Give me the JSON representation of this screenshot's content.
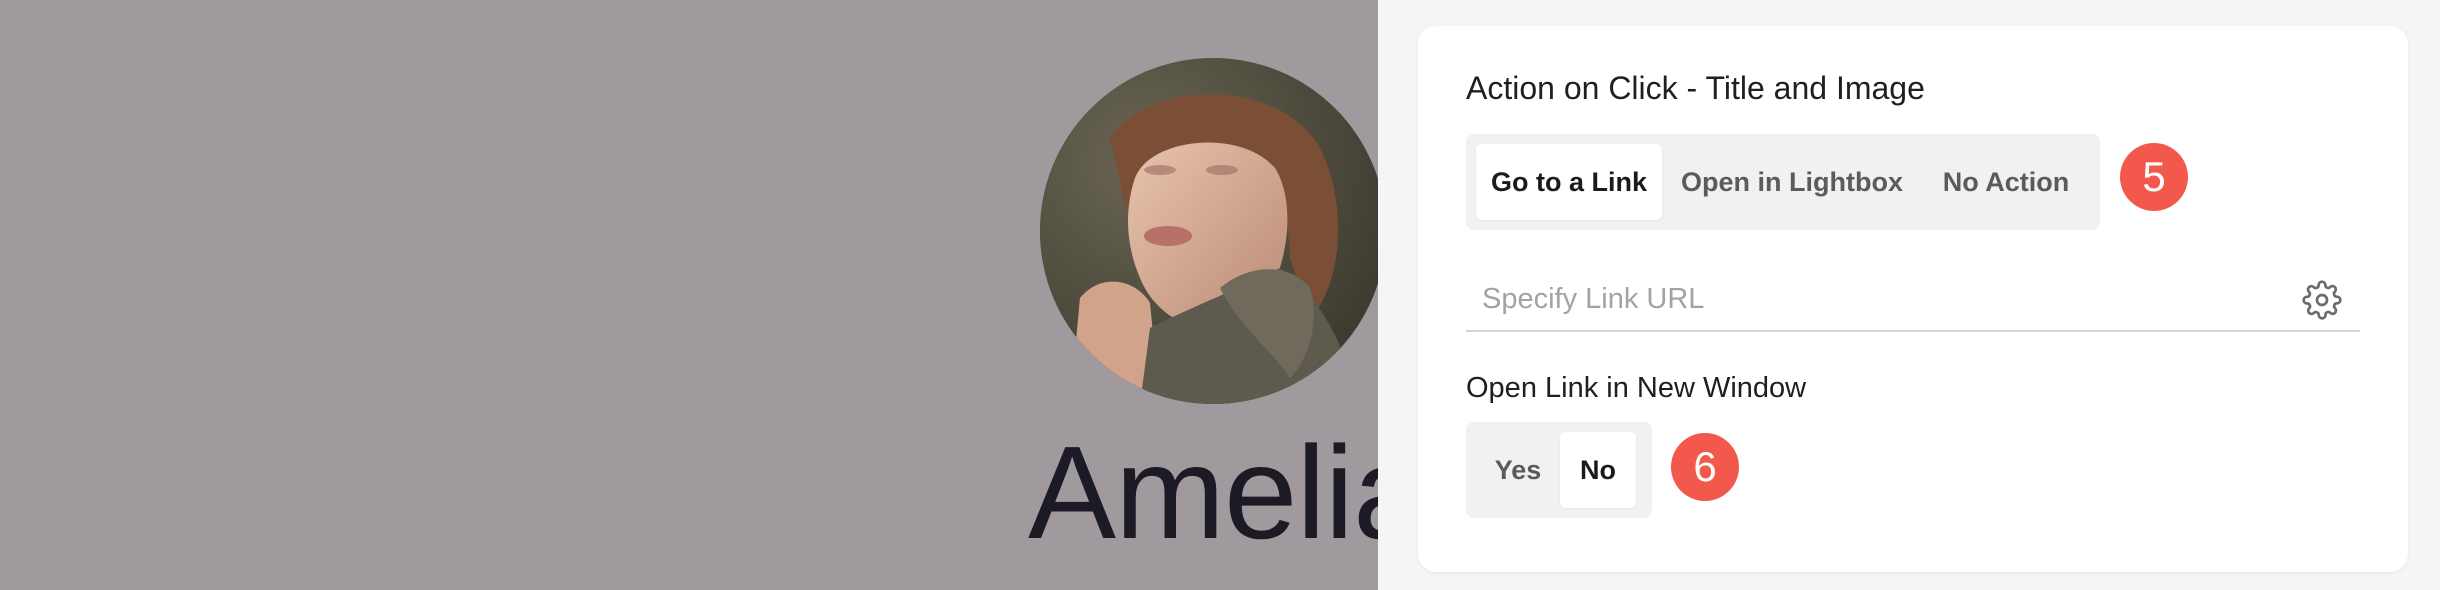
{
  "preview": {
    "name": "Amelia",
    "background_color": "#a09a9e"
  },
  "panel": {
    "action_on_click": {
      "title": "Action on Click - Title and Image",
      "options": [
        "Go to a Link",
        "Open in Lightbox",
        "No Action"
      ],
      "selected": "Go to a Link",
      "step_badge": "5"
    },
    "link_url": {
      "placeholder": "Specify Link URL",
      "value": "",
      "settings_icon": "gear-icon"
    },
    "open_new_window": {
      "title": "Open Link in New Window",
      "options": [
        "Yes",
        "No"
      ],
      "selected": "No",
      "step_badge": "6"
    }
  },
  "colors": {
    "badge": "#f2584b",
    "panel_background": "#f5f5f5",
    "segment_background": "#f1f1f1"
  }
}
